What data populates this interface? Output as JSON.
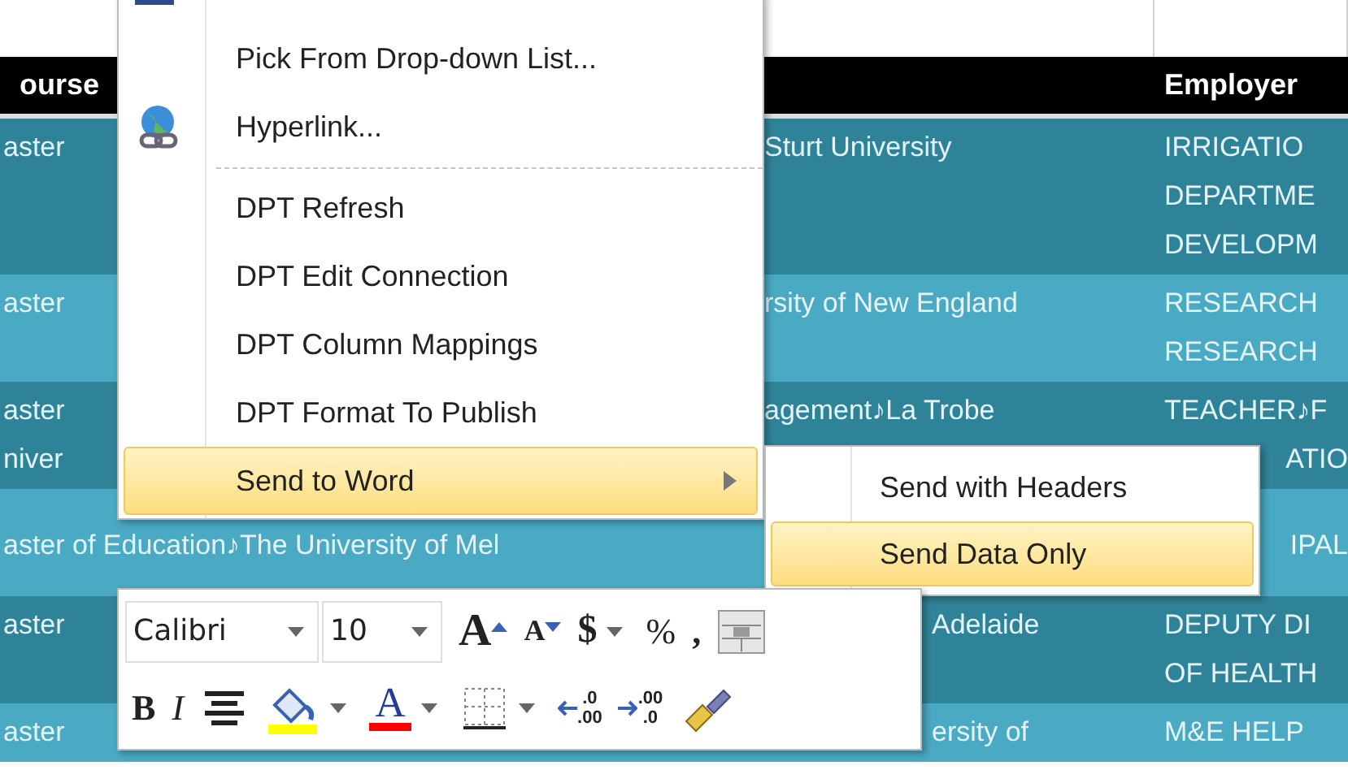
{
  "sheet": {
    "header": {
      "column_1": "ourse",
      "column_3": "Employer"
    },
    "rows": [
      {
        "kind": "dark",
        "column_1": [
          "aster"
        ],
        "column_2": [
          "Sturt University"
        ],
        "column_3": [
          "IRRIGATIO",
          "DEPARTME",
          "DEVELOPM"
        ]
      },
      {
        "kind": "light",
        "column_1": [
          "aster"
        ],
        "column_2": [
          "rsity of New England"
        ],
        "column_3": [
          "RESEARCH",
          "RESEARCH"
        ]
      },
      {
        "kind": "dark",
        "column_1": [
          "aster",
          "niver"
        ],
        "column_2": [
          "agement♪La Trobe"
        ],
        "column_3": [
          "TEACHER♪F",
          "ATIO"
        ]
      },
      {
        "kind": "light",
        "column_1": [
          "aster of Education♪The University of Mel"
        ],
        "column_3": [
          "IPAL"
        ]
      },
      {
        "kind": "dark",
        "column_1": [
          "aster"
        ],
        "column_2": [
          "Adelaide"
        ],
        "column_3": [
          "DEPUTY DI",
          "OF HEALTH"
        ]
      },
      {
        "kind": "light",
        "column_1": [
          "aster"
        ],
        "column_2": [
          "ersity of"
        ],
        "column_3": [
          "M&E HELP"
        ]
      }
    ]
  },
  "context_menu": {
    "items": [
      {
        "kind": "command",
        "label": "Pick From Drop-down List...",
        "selected": false
      },
      {
        "kind": "link",
        "label": "Hyperlink...",
        "selected": false
      },
      {
        "kind": "separator"
      },
      {
        "kind": "command",
        "label": "DPT Refresh",
        "selected": false
      },
      {
        "kind": "command",
        "label": "DPT Edit Connection",
        "selected": false
      },
      {
        "kind": "command",
        "label": "DPT Column Mappings",
        "selected": false
      },
      {
        "kind": "command",
        "label": "DPT Format To Publish",
        "selected": false
      },
      {
        "kind": "submenu",
        "label": "Send to Word",
        "selected": true
      }
    ]
  },
  "submenu": {
    "items": [
      {
        "label": "Send with Headers",
        "selected": false
      },
      {
        "label": "Send Data Only",
        "selected": true
      }
    ]
  },
  "mini_toolbar": {
    "font": "Calibri",
    "size": "10",
    "row_1": [
      {
        "kind": "grow",
        "text": "A"
      },
      {
        "kind": "shrink",
        "text": "A"
      },
      {
        "kind": "currency",
        "text": "$"
      },
      {
        "kind": "percent",
        "text": "%"
      },
      {
        "kind": "comma",
        "text": ","
      },
      {
        "kind": "merge"
      }
    ],
    "row_2": [
      {
        "kind": "bold",
        "text": "B"
      },
      {
        "kind": "italic",
        "text": "I"
      },
      {
        "kind": "center"
      },
      {
        "kind": "fill"
      },
      {
        "kind": "font_color",
        "text": "A"
      },
      {
        "kind": "borders"
      },
      {
        "kind": "increase_decimal",
        "lines": [
          ".0",
          ".00"
        ]
      },
      {
        "kind": "decrease_decimal",
        "lines": [
          ".00",
          ".0"
        ]
      },
      {
        "kind": "painter"
      }
    ]
  }
}
